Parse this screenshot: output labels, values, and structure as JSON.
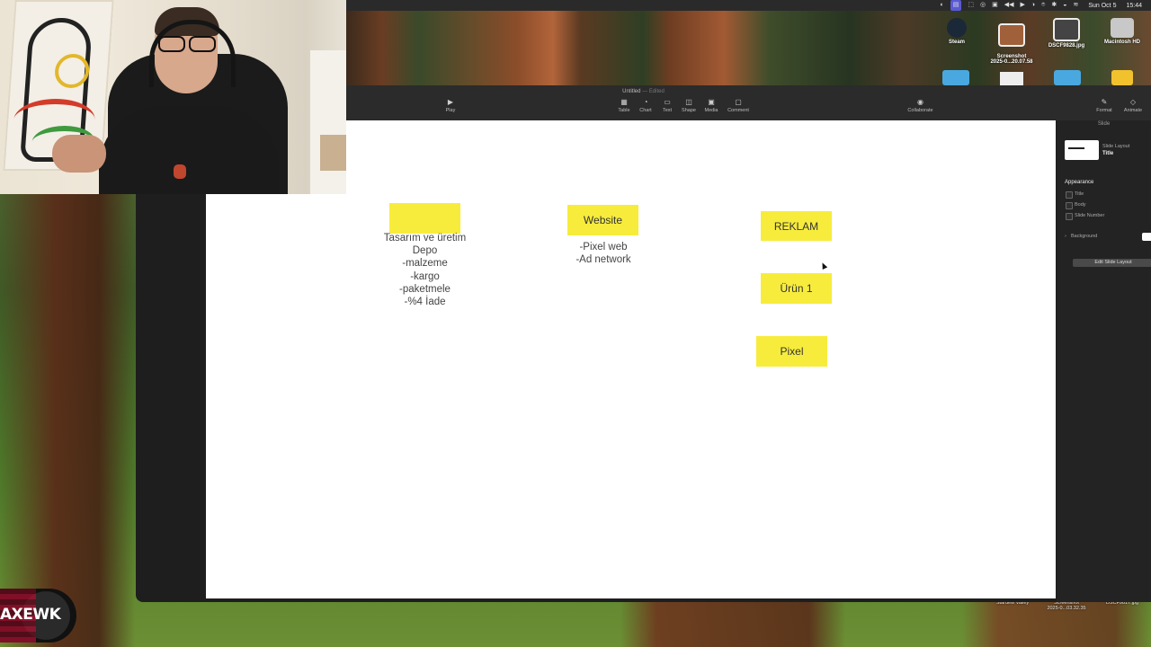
{
  "menubar": {
    "items": [
      "◐",
      "▤",
      "⬚",
      "◎",
      "▣",
      "◀◀",
      "▶",
      "◑",
      "⌾",
      "✱",
      "◒",
      "≋"
    ],
    "date": "Sun Oct 5",
    "time": "15:44"
  },
  "desktop": {
    "icons": [
      {
        "label": "Steam",
        "color": "#1b2838"
      },
      {
        "label": "Screenshot\n2025-0...20.07.58",
        "color": "#a0603a"
      },
      {
        "label": "DSCF9828.jpg",
        "color": "#444"
      },
      {
        "label": "Macintosh HD",
        "color": "#bbb"
      }
    ],
    "bottom_labels": [
      "Stardew Valley",
      "Screenshot\n2025-0...03.32.35",
      "DSCF9817.jpg"
    ]
  },
  "window": {
    "title": "Untitled",
    "title_suffix": "— Edited",
    "toolbar": {
      "play": "Play",
      "table": "Table",
      "chart": "Chart",
      "text": "Text",
      "shape": "Shape",
      "media": "Media",
      "comment": "Comment",
      "collaborate": "Collaborate",
      "format": "Format",
      "animate": "Animate"
    }
  },
  "slide": {
    "col1_notes": [
      "Tasarım ve üretim",
      "Depo",
      "-malzeme",
      "-kargo",
      "-paketmele",
      "-%4 İade"
    ],
    "website_label": "Website",
    "col2_notes": [
      "-Pixel web",
      "-Ad network"
    ],
    "reklam_label": "REKLAM",
    "urun_label": "Ürün 1",
    "pixel_label": "Pixel"
  },
  "inspector": {
    "tab": "Slide",
    "slide_layout_label": "Slide Layout",
    "slide_layout_value": "Title",
    "appearance": "Appearance",
    "options": [
      "Title",
      "Body",
      "Slide Number"
    ],
    "background": "Background",
    "edit_button": "Edit Slide Layout"
  },
  "badge": {
    "text": "AXEWK"
  },
  "colors": {
    "sticky": "#f7ec3c",
    "slide_bg": "#ffffff",
    "window_bg": "#1e1e1e"
  }
}
